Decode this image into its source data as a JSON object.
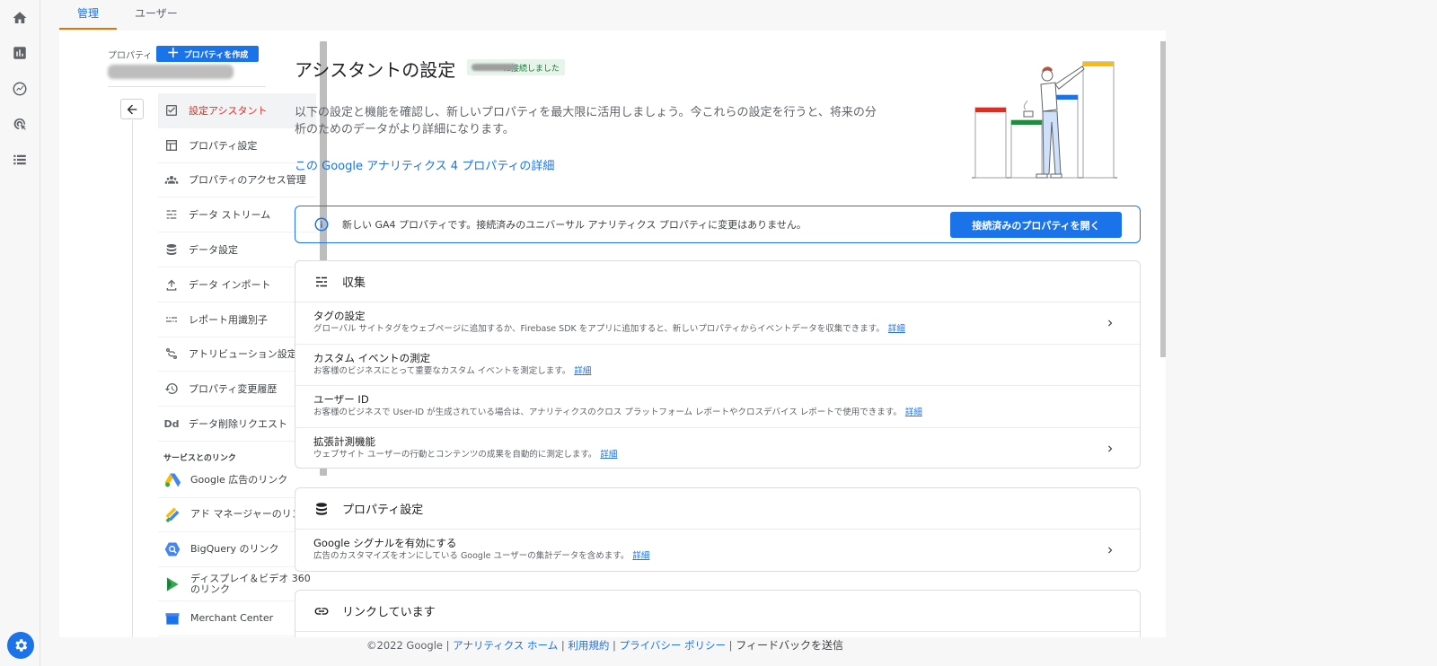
{
  "tabs": [
    "管理",
    "ユーザー"
  ],
  "nav": {
    "property_label": "プロパティ",
    "create_button": "プロパティを作成",
    "items": [
      {
        "label": "設定アシスタント",
        "icon": "checkbox-icon",
        "active": true
      },
      {
        "label": "プロパティ設定",
        "icon": "layout-icon"
      },
      {
        "label": "プロパティのアクセス管理",
        "icon": "people-icon"
      },
      {
        "label": "データ ストリーム",
        "icon": "streams-icon"
      },
      {
        "label": "データ設定",
        "icon": "database-icon"
      },
      {
        "label": "データ インポート",
        "icon": "upload-icon"
      },
      {
        "label": "レポート用識別子",
        "icon": "identity-icon"
      },
      {
        "label": "アトリビューション設定",
        "icon": "attribution-icon"
      },
      {
        "label": "プロパティ変更履歴",
        "icon": "history-icon"
      },
      {
        "label": "データ削除リクエスト",
        "icon": "dd-icon",
        "icon_text": "Dd"
      }
    ],
    "links_section": "サービスとのリンク",
    "links": [
      {
        "label": "Google 広告のリンク",
        "icon": "google-ads-icon"
      },
      {
        "label": "アド マネージャーのリンク",
        "icon": "ad-manager-icon"
      },
      {
        "label": "BigQuery のリンク",
        "icon": "bigquery-icon"
      },
      {
        "label": "ディスプレイ＆ビデオ 360 のリンク",
        "icon": "dv360-icon"
      },
      {
        "label": "Merchant Center",
        "icon": "merchant-icon"
      }
    ]
  },
  "main": {
    "title": "アシスタントの設定",
    "status_chip": "に接続しました",
    "intro": "以下の設定と機能を確認し、新しいプロパティを最大限に活用しましょう。今これらの設定を行うと、将来の分析のためのデータがより詳細になります。",
    "detail_link": "この Google アナリティクス 4 プロパティの詳細",
    "banner": {
      "text": "新しい GA4 プロパティです。接続済みのユニバーサル アナリティクス プロパティに変更はありません。",
      "button": "接続済みのプロパティを開く"
    },
    "collection": {
      "title": "収集",
      "rows": [
        {
          "title": "タグの設定",
          "desc": "グローバル サイトタグをウェブページに追加するか、Firebase SDK をアプリに追加すると、新しいプロパティからイベントデータを収集できます。",
          "link": "詳細",
          "chevron": true
        },
        {
          "title": "カスタム イベントの測定",
          "desc": "お客様のビジネスにとって重要なカスタム イベントを測定します。",
          "link": "詳細",
          "chevron": false
        },
        {
          "title": "ユーザー ID",
          "desc": "お客様のビジネスで User-ID が生成されている場合は、アナリティクスのクロス プラットフォーム レポートやクロスデバイス レポートで使用できます。",
          "link": "詳細",
          "chevron": false
        },
        {
          "title": "拡張計測機能",
          "desc": "ウェブサイト ユーザーの行動とコンテンツの成果を自動的に測定します。",
          "link": "詳細",
          "chevron": true
        }
      ]
    },
    "property_settings": {
      "title": "プロパティ設定",
      "rows": [
        {
          "title": "Google シグナルを有効にする",
          "desc": "広告のカスタマイズをオンにしている Google ユーザーの集計データを含めます。",
          "link": "詳細",
          "chevron": true
        }
      ]
    },
    "linking": {
      "title": "リンクしています"
    }
  },
  "footer": {
    "copyright": "©2022 Google",
    "links": [
      "アナリティクス ホーム",
      "利用規約",
      "プライバシー ポリシー"
    ],
    "feedback": "フィードバックを送信"
  },
  "colors": {
    "accent": "#1a73e8",
    "active_nav": "#d93025",
    "tab_underline": "#e37400",
    "chip_bg": "#e6f4ea"
  }
}
